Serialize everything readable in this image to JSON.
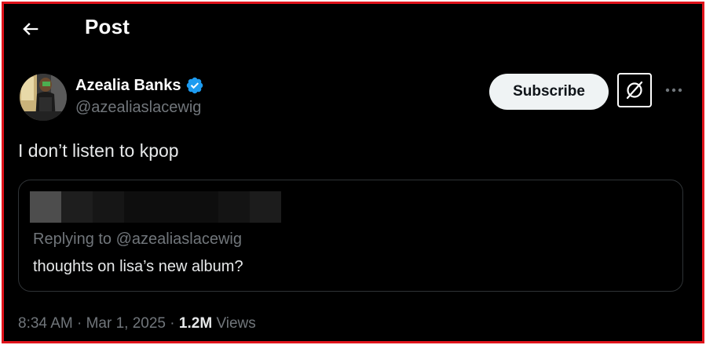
{
  "header": {
    "title": "Post"
  },
  "post": {
    "author": {
      "name": "Azealia Banks",
      "handle": "@azealiaslacewig",
      "verified": true
    },
    "subscribe_label": "Subscribe",
    "text": "I don’t listen to kpop",
    "quoted": {
      "replying_to": "Replying to @azealiaslacewig",
      "text": "thoughts on lisa’s new album?"
    },
    "meta": {
      "time": "8:34 AM",
      "separator": "·",
      "date": "Mar 1, 2025",
      "views_count": "1.2M",
      "views_label": "Views"
    }
  },
  "icons": {
    "back": "back-arrow-icon",
    "verified": "verified-badge-icon",
    "grok": "grok-icon",
    "more": "more-icon"
  },
  "colors": {
    "background": "#000000",
    "text_primary": "#e7e9ea",
    "text_secondary": "#71767b",
    "verified_blue": "#1d9bf0",
    "border": "#2f3336",
    "subscribe_bg": "#eff3f4",
    "frame_red": "#e0131b"
  }
}
